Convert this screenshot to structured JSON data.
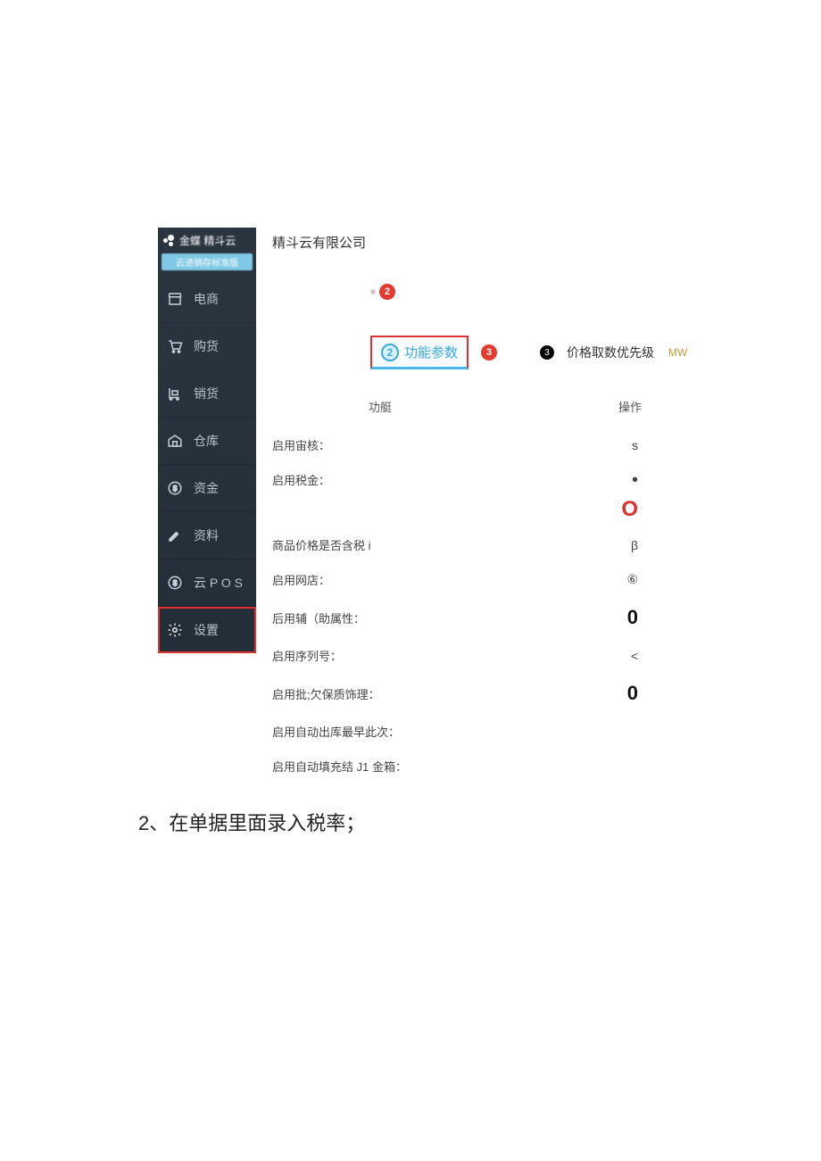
{
  "logo_text": "金蝶 精斗云",
  "edition": "云进销存标准版",
  "sidebar": {
    "items": [
      {
        "label": "电商"
      },
      {
        "label": "购货"
      },
      {
        "label": "销货"
      },
      {
        "label": "仓库"
      },
      {
        "label": "资金"
      },
      {
        "label": "资料"
      },
      {
        "label": "云 P O S"
      },
      {
        "label": "设置"
      }
    ]
  },
  "company": "精斗云有限公司",
  "top_badge": "2",
  "tab": {
    "num": "2",
    "label": "功能参数"
  },
  "after_tab_badge": "3",
  "priority": {
    "bullet": "3",
    "label": "价格取数优先级",
    "suffix": "MW"
  },
  "table": {
    "header_func": "功艇",
    "header_op": "操作",
    "rows": [
      {
        "label": "启用宙核：",
        "value": "s"
      },
      {
        "label": "启用税金：",
        "value": "•",
        "cls": "dot"
      },
      {
        "label": "",
        "value": "O",
        "cls": "red-o"
      },
      {
        "label": "商品价格是否含税 i",
        "value": "β"
      },
      {
        "label": "启用网店：",
        "value": "⑥"
      },
      {
        "label": "后用辅（助属性：",
        "value": "0",
        "cls": "big"
      },
      {
        "label": "启用序列号：",
        "value": "<"
      },
      {
        "label": "启用批;欠保质饰理：",
        "value": "0",
        "cls": "big"
      },
      {
        "label": "启用自动出库最早此次：",
        "value": ""
      },
      {
        "label": "启用自动填充结 J1 金箱：",
        "value": ""
      }
    ]
  },
  "step2_text": "2、在单据里面录入税率；"
}
